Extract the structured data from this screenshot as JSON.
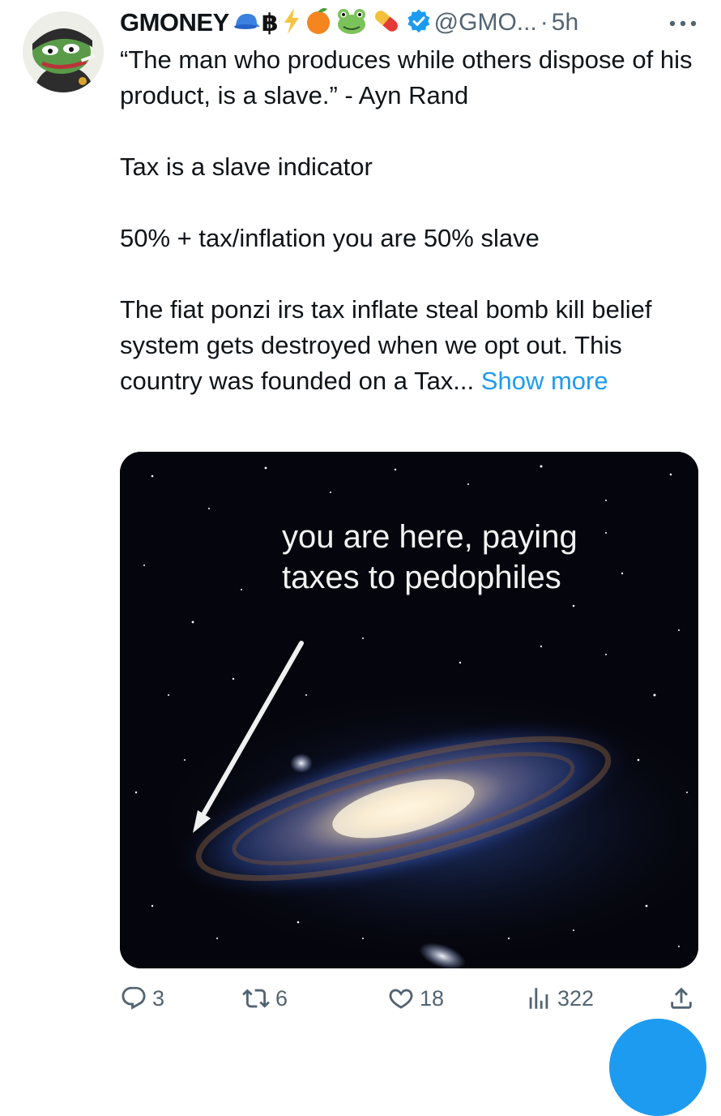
{
  "author": {
    "name": "GMONEY",
    "handle": "@GMO...",
    "separator": "·",
    "time": "5h",
    "name_emojis": [
      "blue-cap-emoji",
      "bitcoin-icon",
      "lightning-emoji",
      "orange-emoji",
      "frog-emoji",
      "pill-emoji"
    ],
    "verified_color": "#1d9bf0"
  },
  "tweet": {
    "paragraphs": [
      "“The man who produces while others dispose of his product, is a slave.” - Ayn Rand",
      "Tax is a slave indicator",
      "50% + tax/inflation you are 50% slave",
      "The fiat ponzi irs tax inflate steal bomb kill belief system gets destroyed when we opt out. This country was founded on a Tax..."
    ],
    "show_more": "Show more"
  },
  "media": {
    "caption_line1": "you are here, paying",
    "caption_line2": "taxes to pedophiles"
  },
  "actions": {
    "replies": "3",
    "reposts": "6",
    "likes": "18",
    "views": "322"
  },
  "colors": {
    "accent": "#1d9bf0",
    "muted": "#536471",
    "text": "#0f1419"
  }
}
